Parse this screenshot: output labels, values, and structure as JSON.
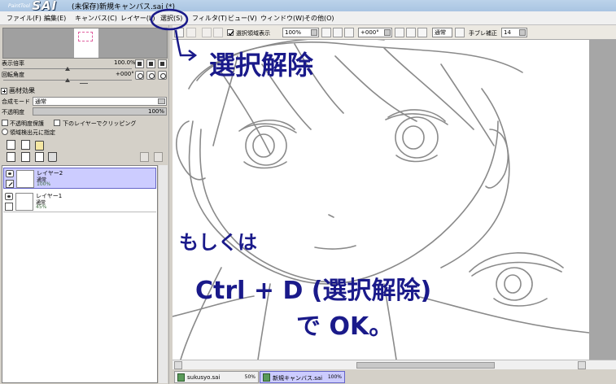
{
  "app": {
    "logo_small": "PaintTool",
    "logo_name": "SAI",
    "window_title": "(未保存)新規キャンバス.sai (*)"
  },
  "menu": [
    {
      "label": "ファイル(F)"
    },
    {
      "label": "編集(E)"
    },
    {
      "label": "キャンバス(C)"
    },
    {
      "label": "レイヤー(L)"
    },
    {
      "label": "選択(S)"
    },
    {
      "label": "フィルタ(T)"
    },
    {
      "label": "ビュー(V)"
    },
    {
      "label": "ウィンドウ(W)"
    },
    {
      "label": "その他(O)"
    }
  ],
  "navigator": {
    "zoom_label": "表示倍率",
    "zoom_value": "100.0%",
    "rotation_label": "回転角度",
    "rotation_value": "+000°"
  },
  "paper_effect": {
    "header": "画材効果",
    "blend_label": "合成モード",
    "blend_value": "通常",
    "opacity_label": "不透明度",
    "opacity_value": "100%",
    "preserve_opacity": "不透明度保護",
    "clip_lower": "下のレイヤーでクリッピング",
    "selection_source": "領域検出元に指定"
  },
  "layers": [
    {
      "name": "レイヤー2",
      "mode": "通常",
      "opacity": "100%",
      "selected": true
    },
    {
      "name": "レイヤー1",
      "mode": "通常",
      "opacity": "45%",
      "selected": false
    }
  ],
  "toolbar": {
    "show_selection_label": "選択領域表示",
    "zoom": "100%",
    "rotation": "+000°",
    "blend_mode": "通常",
    "stabilizer_label": "手ブレ補正",
    "stabilizer_value": "14"
  },
  "annotations": {
    "deselect": "選択解除",
    "or": "もしくは",
    "shortcut": "Ctrl + D (選択解除)",
    "ok": "で OK。"
  },
  "tabs": [
    {
      "label": "sukusyo.sai",
      "zoom": "50%",
      "active": false
    },
    {
      "label": "新規キャンバス.sai",
      "zoom": "100%",
      "active": true
    }
  ],
  "colors": {
    "annotation_ink": "#1a1a8a",
    "sketch_gray": "#8a8a8a",
    "selected_layer": "#ccccff"
  }
}
